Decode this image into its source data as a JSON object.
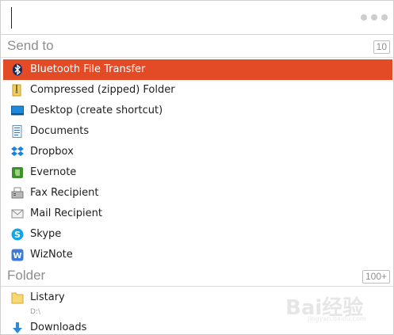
{
  "search": {
    "value": ""
  },
  "send_to": {
    "title": "Send to",
    "count": "10",
    "items": [
      {
        "label": "Bluetooth File Transfer",
        "icon": "bluetooth-icon"
      },
      {
        "label": "Compressed (zipped) Folder",
        "icon": "zip-folder-icon"
      },
      {
        "label": "Desktop (create shortcut)",
        "icon": "desktop-icon"
      },
      {
        "label": "Documents",
        "icon": "documents-icon"
      },
      {
        "label": "Dropbox",
        "icon": "dropbox-icon"
      },
      {
        "label": "Evernote",
        "icon": "evernote-icon"
      },
      {
        "label": "Fax Recipient",
        "icon": "fax-icon"
      },
      {
        "label": "Mail Recipient",
        "icon": "mail-icon"
      },
      {
        "label": "Skype",
        "icon": "skype-icon"
      },
      {
        "label": "WizNote",
        "icon": "wiznote-icon"
      }
    ]
  },
  "folder": {
    "title": "Folder",
    "count": "100+",
    "items": [
      {
        "label": "Listary",
        "sub": "D:\\",
        "icon": "folder-icon"
      },
      {
        "label": "Downloads",
        "icon": "download-icon"
      }
    ]
  },
  "watermark": {
    "text": "Bai经验",
    "url": "jingyan.baidu.com"
  },
  "colors": {
    "selection": "#e34b26",
    "section_text": "#8e8e8e"
  }
}
